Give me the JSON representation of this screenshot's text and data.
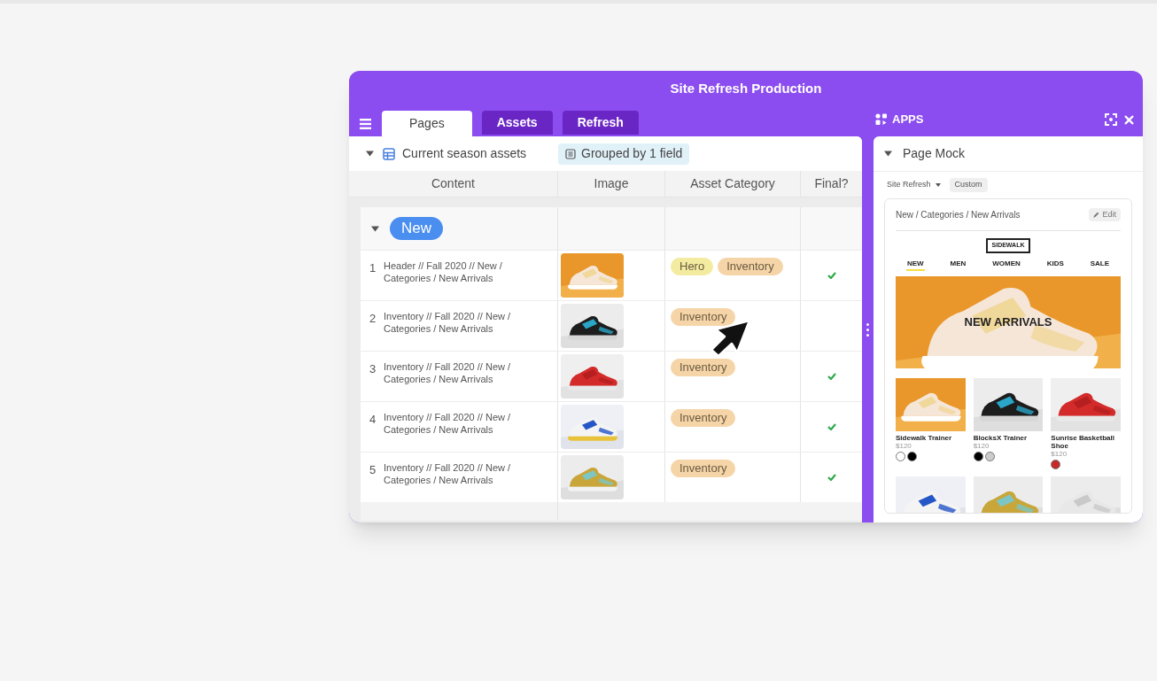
{
  "window": {
    "title": "Site Refresh Production"
  },
  "tabs": [
    {
      "label": "Pages",
      "selected": true
    },
    {
      "label": "Assets",
      "selected": false
    },
    {
      "label": "Refresh",
      "selected": false
    }
  ],
  "view": {
    "name": "Current season assets",
    "expanded": true,
    "grouping": "Grouped by 1 field"
  },
  "table": {
    "columns": [
      "Content",
      "Image",
      "Asset Category",
      "Final?"
    ],
    "group": {
      "label": "New",
      "expanded": true
    },
    "rows": [
      {
        "number": "1",
        "content": "Header // Fall 2020 // New / Categories / New Arrivals",
        "categories": [
          {
            "label": "Hero",
            "color": "#f3eca0"
          },
          {
            "label": "Inventory",
            "color": "#f5d5a8"
          }
        ],
        "final": true
      },
      {
        "number": "2",
        "content": "Inventory // Fall 2020 // New / Categories / New Arrivals",
        "categories": [
          {
            "label": "Inventory",
            "color": "#f5d5a8"
          }
        ],
        "final": false
      },
      {
        "number": "3",
        "content": "Inventory // Fall 2020 // New / Categories / New Arrivals",
        "categories": [
          {
            "label": "Inventory",
            "color": "#f5d5a8"
          }
        ],
        "final": true
      },
      {
        "number": "4",
        "content": "Inventory // Fall 2020 // New / Categories / New Arrivals",
        "categories": [
          {
            "label": "Inventory",
            "color": "#f5d5a8"
          }
        ],
        "final": true
      },
      {
        "number": "5",
        "content": "Inventory // Fall 2020 // New / Categories / New Arrivals",
        "categories": [
          {
            "label": "Inventory",
            "color": "#f5d5a8"
          }
        ],
        "final": true
      }
    ]
  },
  "apps": {
    "title": "APPS",
    "block": {
      "title": "Page Mock",
      "expanded": true
    },
    "source": "Site Refresh",
    "mode": "Custom",
    "mock": {
      "breadcrumb": "New / Categories / New Arrivals",
      "edit": "Edit",
      "logo": "SIDEWALK",
      "nav": [
        {
          "label": "NEW",
          "selected": true
        },
        {
          "label": "MEN",
          "selected": false
        },
        {
          "label": "WOMEN",
          "selected": false
        },
        {
          "label": "KIDS",
          "selected": false
        },
        {
          "label": "SALE",
          "selected": false
        }
      ],
      "hero": "NEW ARRIVALS",
      "products": [
        {
          "name": "Sidewalk Trainer",
          "price": "$120",
          "swatches": [
            {
              "color": "#ffffff"
            },
            {
              "color": "#000000"
            }
          ]
        },
        {
          "name": "BlocksX Trainer",
          "price": "$120",
          "swatches": [
            {
              "color": "#000000"
            },
            {
              "color": "#cccccc"
            }
          ]
        },
        {
          "name": "Sunrise Basketball Shoe",
          "price": "$120",
          "swatches": [
            {
              "color": "#c62828"
            }
          ]
        }
      ]
    }
  }
}
